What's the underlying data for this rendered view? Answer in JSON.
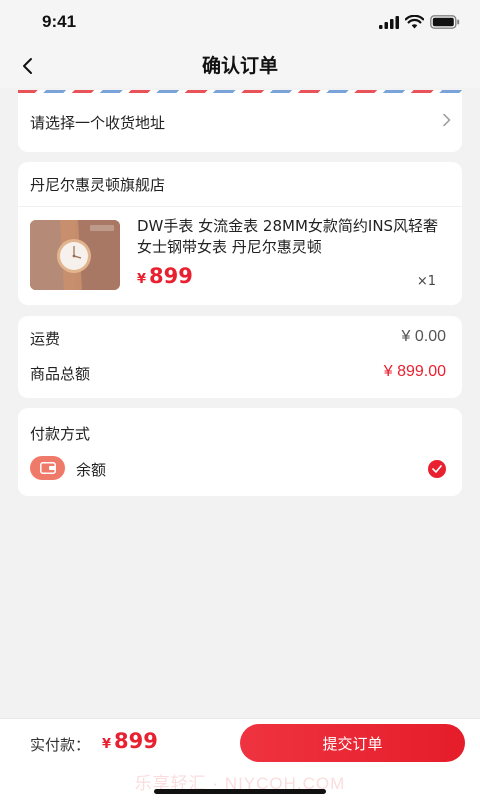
{
  "status_bar": {
    "time": "9:41"
  },
  "nav": {
    "title": "确认订单"
  },
  "address": {
    "placeholder": "请选择一个收货地址"
  },
  "shop": {
    "name": "丹尼尔惠灵顿旗舰店",
    "product": {
      "title": "DW手表 女流金表 28MM女款简约INS风轻奢女士钢带女表 丹尼尔惠灵顿",
      "price_currency": "¥",
      "price": "899",
      "quantity": "×1"
    }
  },
  "summary": {
    "shipping_label": "运费",
    "shipping_value": "¥ 0.00",
    "total_label": "商品总额",
    "total_value": "¥ 899.00"
  },
  "payment": {
    "title": "付款方式",
    "method_label": "余额",
    "selected": true
  },
  "bottom": {
    "pay_label": "实付款：",
    "pay_currency": "¥",
    "pay_amount": "899",
    "submit_label": "提交订单",
    "watermark": "乐享轻汇 · NIYCOH.COM"
  },
  "colors": {
    "accent": "#e8202f",
    "background": "#f2f2f2",
    "card": "#ffffff"
  },
  "icons": [
    "back-icon",
    "chevron-right-icon",
    "wallet-icon",
    "check-icon",
    "signal-icon",
    "wifi-icon",
    "battery-icon"
  ]
}
